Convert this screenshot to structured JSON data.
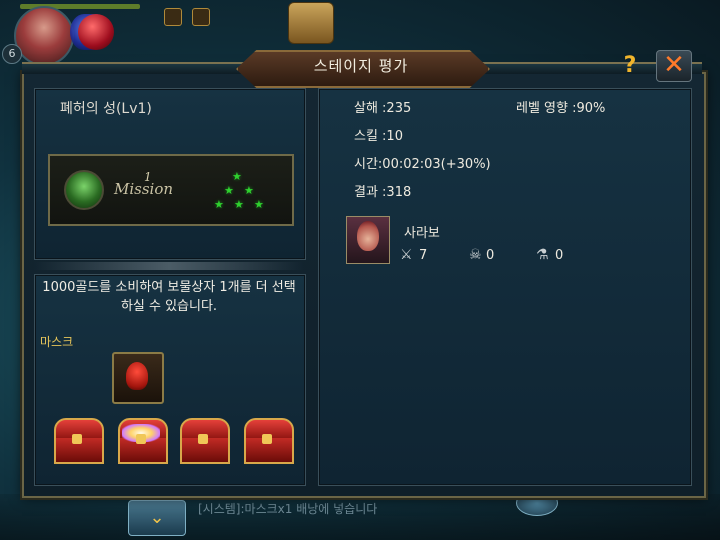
{
  "hud": {
    "player_level": "6"
  },
  "dialog": {
    "title": "스테이지 평가",
    "help_label": "?",
    "close_label": "✕"
  },
  "stage": {
    "name": "폐허의 성(Lv1)",
    "mission_label": "Mission",
    "mission_number": "1",
    "stars": 6
  },
  "bonus": {
    "description": "1000골드를 소비하여 보물상자 1개를 더 선택하실 수 있습니다.",
    "reward_name": "마스크",
    "chests": [
      {
        "state": "closed"
      },
      {
        "state": "opened"
      },
      {
        "state": "closed"
      },
      {
        "state": "closed"
      }
    ]
  },
  "results": {
    "kills": "살해 :235",
    "level_effect": "레벨 영향 :90%",
    "skill": "스킬 :10",
    "time": "시간:00:02:03(+30%)",
    "result": "결과 :318",
    "character": {
      "name": "사라보",
      "swords_icon": "⚔",
      "swords_value": "7",
      "skull_icon": "☠",
      "skull_value": "0",
      "potion_icon": "⚗",
      "potion_value": "0"
    }
  },
  "chat": {
    "system_message": "[시스템]:마스크x1 배낭에 넣습니다",
    "expand_icon": "chevron-double-down-icon"
  },
  "colors": {
    "panel_border": "#6b6546",
    "accent_gold": "#e5c45a",
    "star_green": "#2fd12f",
    "close_orange": "#ff7a2a"
  }
}
